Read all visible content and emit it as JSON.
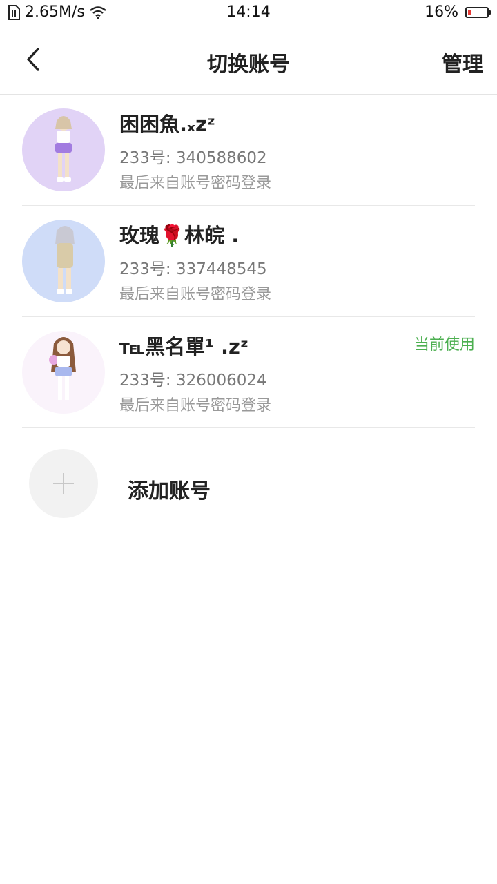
{
  "status_bar": {
    "network_speed": "2.65M/s",
    "time": "14:14",
    "battery_percent": "16%",
    "battery_level": 0.16,
    "battery_color": "#e53935"
  },
  "header": {
    "title": "切换账号",
    "manage_label": "管理"
  },
  "accounts": [
    {
      "name": "困困魚.ₓzᶻ",
      "id_line": "233号: 340588602",
      "login_line": "最后来自账号密码登录",
      "current": false,
      "avatar_bg": "#e1d3f6"
    },
    {
      "name": "玫瑰🌹林皖 .",
      "id_line": "233号: 337448545",
      "login_line": "最后来自账号密码登录",
      "current": false,
      "avatar_bg": "#cfdcf8"
    },
    {
      "name": "℡黑名單¹ .zᶻ",
      "id_line": "233号: 326006024",
      "login_line": "最后来自账号密码登录",
      "current": true,
      "current_label": "当前使用",
      "avatar_bg": "#faf3fb"
    }
  ],
  "add_account": {
    "label": "添加账号"
  },
  "colors": {
    "accent_green": "#4caf50",
    "text_primary": "#222222",
    "text_secondary": "#777777",
    "divider": "#e8e8e8"
  }
}
